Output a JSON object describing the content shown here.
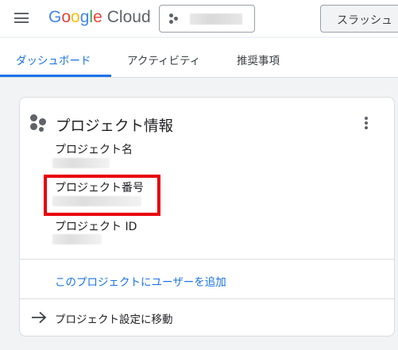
{
  "header": {
    "logo_google": "Google",
    "logo_cloud": "Cloud",
    "search_label": "スラッシュ"
  },
  "tabs": [
    {
      "label": "ダッシュボード",
      "active": true
    },
    {
      "label": "アクティビティ",
      "active": false
    },
    {
      "label": "推奨事項",
      "active": false
    }
  ],
  "project_info": {
    "title": "プロジェクト情報",
    "fields": [
      {
        "label": "プロジェクト名",
        "value_redacted": true
      },
      {
        "label": "プロジェクト番号",
        "value_redacted": true
      },
      {
        "label": "プロジェクト ID",
        "value_redacted": true
      }
    ],
    "add_user_link": "このプロジェクトにユーザーを追加",
    "settings_link": "プロジェクト設定に移動"
  },
  "colors": {
    "accent": "#1a73e8",
    "highlight": "#e8000b"
  },
  "icons": {
    "menu": "hamburger-menu-icon",
    "project": "project-hexagon-icon",
    "more": "more-vert-icon",
    "arrow": "arrow-forward-icon"
  }
}
